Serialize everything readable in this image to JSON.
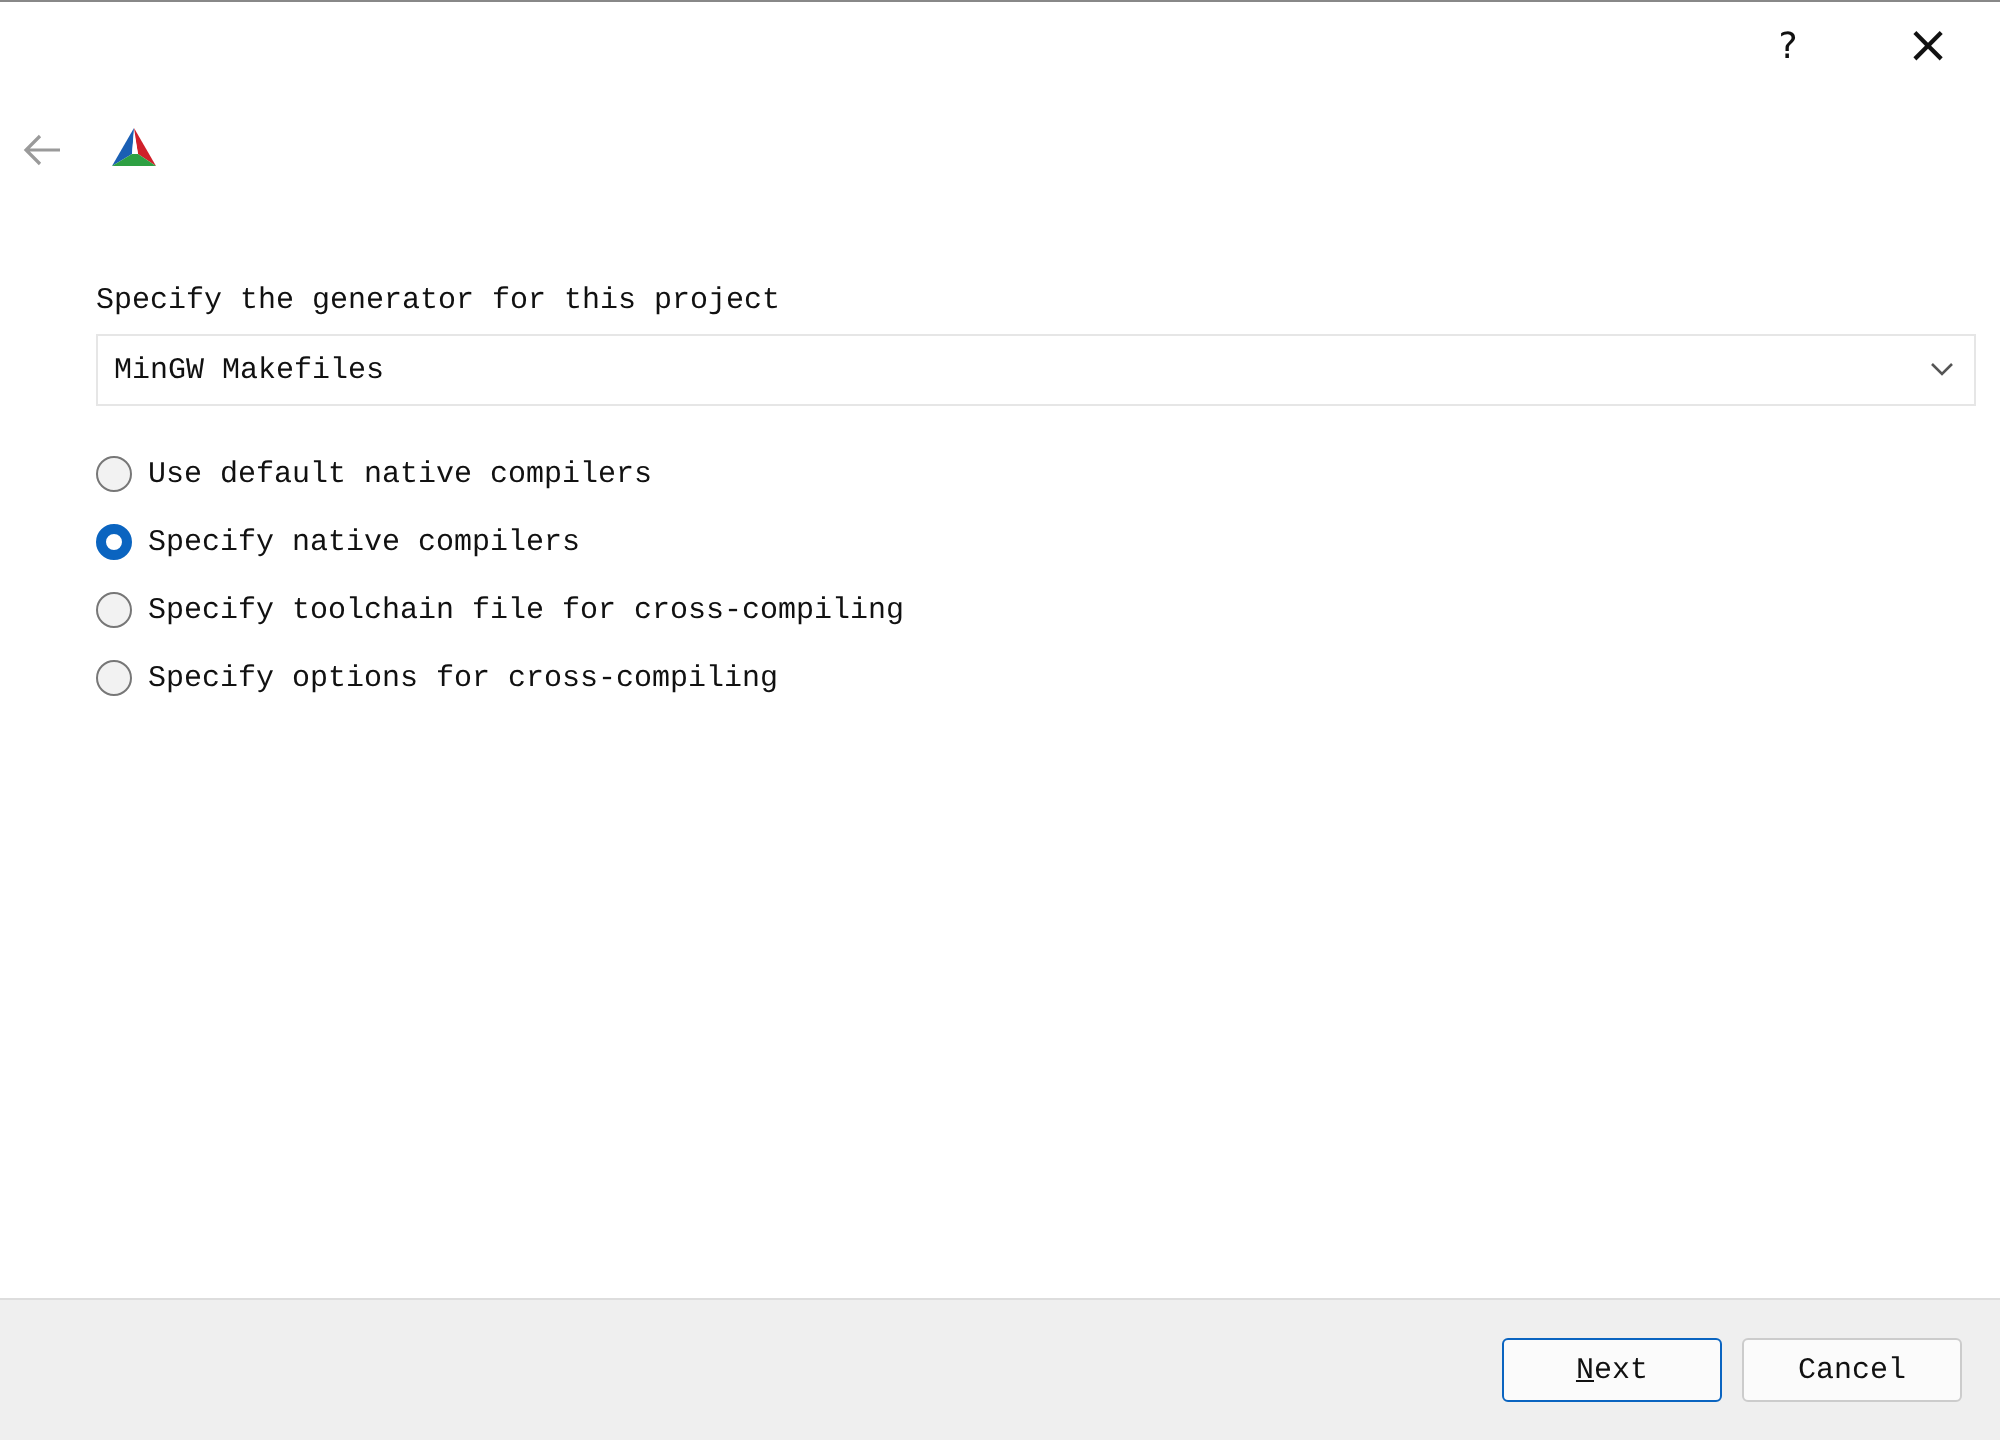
{
  "title_bar": {
    "help": "?",
    "close": "×"
  },
  "generator": {
    "label": "Specify the generator for this project",
    "value": "MinGW Makefiles"
  },
  "options": [
    {
      "label": "Use default native compilers",
      "selected": false
    },
    {
      "label": "Specify native compilers",
      "selected": true
    },
    {
      "label": "Specify toolchain file for cross-compiling",
      "selected": false
    },
    {
      "label": "Specify options for cross-compiling",
      "selected": false
    }
  ],
  "buttons": [
    {
      "label": "Next",
      "default": true,
      "mnemonic": true
    },
    {
      "label": "Cancel",
      "default": false,
      "mnemonic": false
    }
  ]
}
